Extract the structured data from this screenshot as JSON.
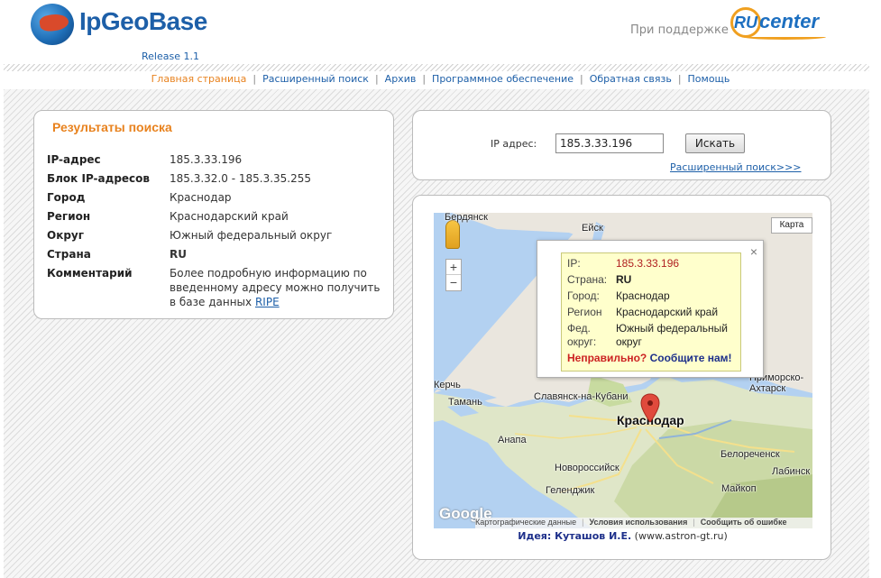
{
  "header": {
    "logo_text": "IpGeoBase",
    "release": "Release 1.1",
    "support_text": "При поддержке",
    "partner_logo_text": "center",
    "partner_badge": "RU"
  },
  "nav": {
    "items": [
      {
        "label": "Главная страница",
        "active": true
      },
      {
        "label": "Расширенный поиск",
        "active": false
      },
      {
        "label": "Архив",
        "active": false
      },
      {
        "label": "Программное обеспечение",
        "active": false
      },
      {
        "label": "Обратная связь",
        "active": false
      },
      {
        "label": "Помощь",
        "active": false
      }
    ],
    "separator": "|"
  },
  "results": {
    "title": "Результаты поиска",
    "rows": [
      {
        "label": "IP-адрес",
        "value": "185.3.33.196"
      },
      {
        "label": "Блок IP-адресов",
        "value": "185.3.32.0 - 185.3.35.255"
      },
      {
        "label": "Город",
        "value": "Краснодар"
      },
      {
        "label": "Регион",
        "value": "Краснодарский край"
      },
      {
        "label": "Округ",
        "value": "Южный федеральный округ"
      },
      {
        "label": "Страна",
        "value": "RU"
      },
      {
        "label": "Комментарий",
        "value": "Более подробную информацию по введенному адресу можно получить в базе данных",
        "link": "RIPE"
      }
    ]
  },
  "search": {
    "label": "IP адрес:",
    "value": "185.3.33.196",
    "button": "Искать",
    "advanced_link": "Расширенный поиск>>>"
  },
  "map": {
    "type_button": "Карта",
    "zoom_in": "+",
    "zoom_out": "−",
    "cities": [
      {
        "name": "Бердянск"
      },
      {
        "name": "Ейск"
      },
      {
        "name": "Приморско-Ахтарск"
      },
      {
        "name": "Керчь"
      },
      {
        "name": "Тамань"
      },
      {
        "name": "Славянск-на-Кубани"
      },
      {
        "name": "Краснодар"
      },
      {
        "name": "Анапа"
      },
      {
        "name": "Новороссийск"
      },
      {
        "name": "Геленджик"
      },
      {
        "name": "Белореченск"
      },
      {
        "name": "Лабинск"
      },
      {
        "name": "Майкоп"
      }
    ],
    "infowindow": {
      "close": "×",
      "rows": [
        {
          "k": "IP:",
          "v": "185.3.33.196"
        },
        {
          "k": "Страна:",
          "v": "RU"
        },
        {
          "k": "Город:",
          "v": "Краснодар"
        },
        {
          "k": "Регион",
          "v": "Краснодарский край"
        },
        {
          "k": "Фед. округ:",
          "v": "Южный федеральный округ"
        }
      ],
      "wrong": "Неправильно?",
      "report": "Сообщите нам!"
    },
    "google": "Google",
    "footer": [
      "Картографические данные",
      "Условия использования",
      "Сообщить об ошибке"
    ]
  },
  "credits": {
    "prefix": "Идея: Куташов И.Е.",
    "suffix": "(www.astron-gt.ru)"
  }
}
